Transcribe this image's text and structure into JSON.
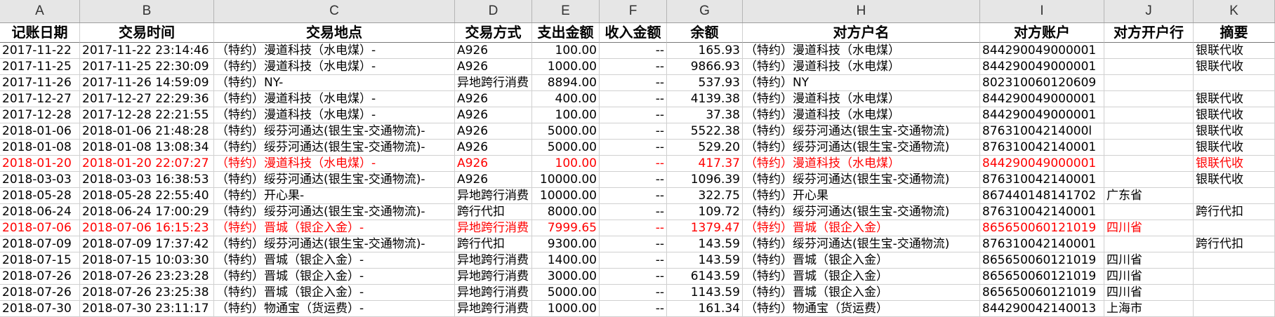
{
  "columns": [
    "A",
    "B",
    "C",
    "D",
    "E",
    "F",
    "G",
    "H",
    "I",
    "J",
    "K"
  ],
  "headers": [
    "记账日期",
    "交易时间",
    "交易地点",
    "交易方式",
    "支出金额",
    "收入金额",
    "余额",
    "对方户名",
    "对方账户",
    "对方开户行",
    "摘要"
  ],
  "rows": [
    {
      "red": false,
      "cells": [
        "2017-11-22",
        "2017-11-22 23:14:46",
        "（特约）漫道科技（水电煤）-",
        "A926",
        "100.00",
        "--",
        "165.93",
        "（特约）漫道科技（水电煤）",
        "844290049000001",
        "",
        "银联代收"
      ]
    },
    {
      "red": false,
      "cells": [
        "2017-11-25",
        "2017-11-25 22:30:09",
        "（特约）漫道科技（水电煤）-",
        "A926",
        "1000.00",
        "--",
        "9866.93",
        "（特约）漫道科技（水电煤）",
        "844290049000001",
        "",
        "银联代收"
      ]
    },
    {
      "red": false,
      "cells": [
        "2017-11-26",
        "2017-11-26 14:59:09",
        "（特约）NY-",
        "异地跨行消费",
        "8894.00",
        "--",
        "537.93",
        "（特约）NY",
        "802310060120609",
        "",
        ""
      ]
    },
    {
      "red": false,
      "cells": [
        "2017-12-27",
        "2017-12-27 22:29:36",
        "（特约）漫道科技（水电煤）-",
        "A926",
        "400.00",
        "--",
        "4139.38",
        "（特约）漫道科技（水电煤）",
        "844290049000001",
        "",
        "银联代收"
      ]
    },
    {
      "red": false,
      "cells": [
        "2017-12-28",
        "2017-12-28 22:21:55",
        "（特约）漫道科技（水电煤）-",
        "A926",
        "100.00",
        "--",
        "37.38",
        "（特约）漫道科技（水电煤）",
        "844290049000001",
        "",
        "银联代收"
      ]
    },
    {
      "red": false,
      "cells": [
        "2018-01-06",
        "2018-01-06 21:48:28",
        "（特约）绥芬河通达(银生宝-交通物流)-",
        "A926",
        "5000.00",
        "--",
        "5522.38",
        "（特约）绥芬河通达(银生宝-交通物流)",
        "87631004214000l",
        "",
        "银联代收"
      ]
    },
    {
      "red": false,
      "cells": [
        "2018-01-08",
        "2018-01-08 13:08:34",
        "（特约）绥芬河通达(银生宝-交通物流)-",
        "A926",
        "5000.00",
        "--",
        "529.20",
        "（特约）绥芬河通达(银生宝-交通物流)",
        "876310042140001",
        "",
        "银联代收"
      ]
    },
    {
      "red": true,
      "cells": [
        "2018-01-20",
        "2018-01-20 22:07:27",
        "（特约）漫道科技（水电煤）-",
        "A926",
        "100.00",
        "--",
        "417.37",
        "（特约）漫道科技（水电煤）",
        "844290049000001",
        "",
        "银联代收"
      ]
    },
    {
      "red": false,
      "cells": [
        "2018-03-03",
        "2018-03-03 16:38:53",
        "（特约）绥芬河通达(银生宝-交通物流)-",
        "A926",
        "10000.00",
        "--",
        "1096.39",
        "（特约）绥芬河通达(银生宝-交通物流)",
        "876310042140001",
        "",
        "银联代收"
      ]
    },
    {
      "red": false,
      "cells": [
        "2018-05-28",
        "2018-05-28 22:55:40",
        "（特约）开心果-",
        "异地跨行消费",
        "10000.00",
        "--",
        "322.75",
        "（特约）开心果",
        "867440148141702",
        "广东省",
        ""
      ]
    },
    {
      "red": false,
      "cells": [
        "2018-06-24",
        "2018-06-24 17:00:29",
        "（特约）绥芬河通达(银生宝-交通物流)-",
        "跨行代扣",
        "8000.00",
        "--",
        "109.72",
        "（特约）绥芬河通达(银生宝-交通物流)",
        "876310042140001",
        "",
        "跨行代扣"
      ]
    },
    {
      "red": true,
      "cells": [
        "2018-07-06",
        "2018-07-06 16:15:23",
        "（特约）晋城（银企入金）-",
        "异地跨行消费",
        "7999.65",
        "--",
        "1379.47",
        "（特约）晋城（银企入金）",
        "865650060121019",
        "四川省",
        ""
      ]
    },
    {
      "red": false,
      "cells": [
        "2018-07-09",
        "2018-07-09 17:37:42",
        "（特约）绥芬河通达(银生宝-交通物流)-",
        "跨行代扣",
        "9300.00",
        "--",
        "143.59",
        "（特约）绥芬河通达(银生宝-交通物流)",
        "876310042140001",
        "",
        "跨行代扣"
      ]
    },
    {
      "red": false,
      "cells": [
        "2018-07-15",
        "2018-07-15 10:03:30",
        "（特约）晋城（银企入金）-",
        "异地跨行消费",
        "1400.00",
        "--",
        "143.59",
        "（特约）晋城（银企入金）",
        "865650060121019",
        "四川省",
        ""
      ]
    },
    {
      "red": false,
      "cells": [
        "2018-07-26",
        "2018-07-26 23:23:28",
        "（特约）晋城（银企入金）-",
        "异地跨行消费",
        "3000.00",
        "--",
        "6143.59",
        "（特约）晋城（银企入金）",
        "865650060121019",
        "四川省",
        ""
      ]
    },
    {
      "red": false,
      "cells": [
        "2018-07-26",
        "2018-07-26 23:25:38",
        "（特约）晋城（银企入金）-",
        "异地跨行消费",
        "5000.00",
        "--",
        "1143.59",
        "（特约）晋城（银企入金）",
        "865650060121019",
        "四川省",
        ""
      ]
    },
    {
      "red": false,
      "cells": [
        "2018-07-30",
        "2018-07-30 23:11:17",
        "（特约）物通宝（货运费）-",
        "异地跨行消费",
        "1000.00",
        "--",
        "161.34",
        "（特约）物通宝（货运费）",
        "844290042140013",
        "上海市",
        ""
      ]
    }
  ]
}
